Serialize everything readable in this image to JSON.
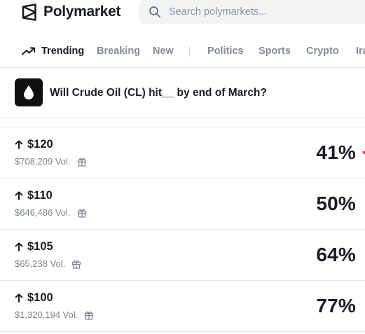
{
  "header": {
    "brand": "Polymarket",
    "search_placeholder": "Search polymarkets..."
  },
  "nav": {
    "items": [
      {
        "label": "Trending",
        "active": true
      },
      {
        "label": "Breaking",
        "active": false
      },
      {
        "label": "New",
        "active": false
      },
      {
        "label": "Politics",
        "active": false
      },
      {
        "label": "Sports",
        "active": false
      },
      {
        "label": "Crypto",
        "active": false
      },
      {
        "label": "Iran",
        "active": false
      }
    ]
  },
  "market": {
    "title": "Will Crude Oil (CL) hit__ by end of March?",
    "icon": "oil-drop-icon"
  },
  "outcomes": [
    {
      "label": "$120",
      "volume": "$708,209 Vol.",
      "probability": "41%",
      "direction": "up"
    },
    {
      "label": "$110",
      "volume": "$646,486 Vol.",
      "probability": "50%",
      "direction": "up"
    },
    {
      "label": "$105",
      "volume": "$65,238 Vol.",
      "probability": "64%",
      "direction": "up"
    },
    {
      "label": "$100",
      "volume": "$1,320,194 Vol.",
      "probability": "77%",
      "direction": "up"
    }
  ],
  "colors": {
    "text": "#1a1d24",
    "muted": "#858b94",
    "divider": "#e6e8eb",
    "search_bg": "#f2f3f5",
    "no_accent": "#e23c50"
  }
}
